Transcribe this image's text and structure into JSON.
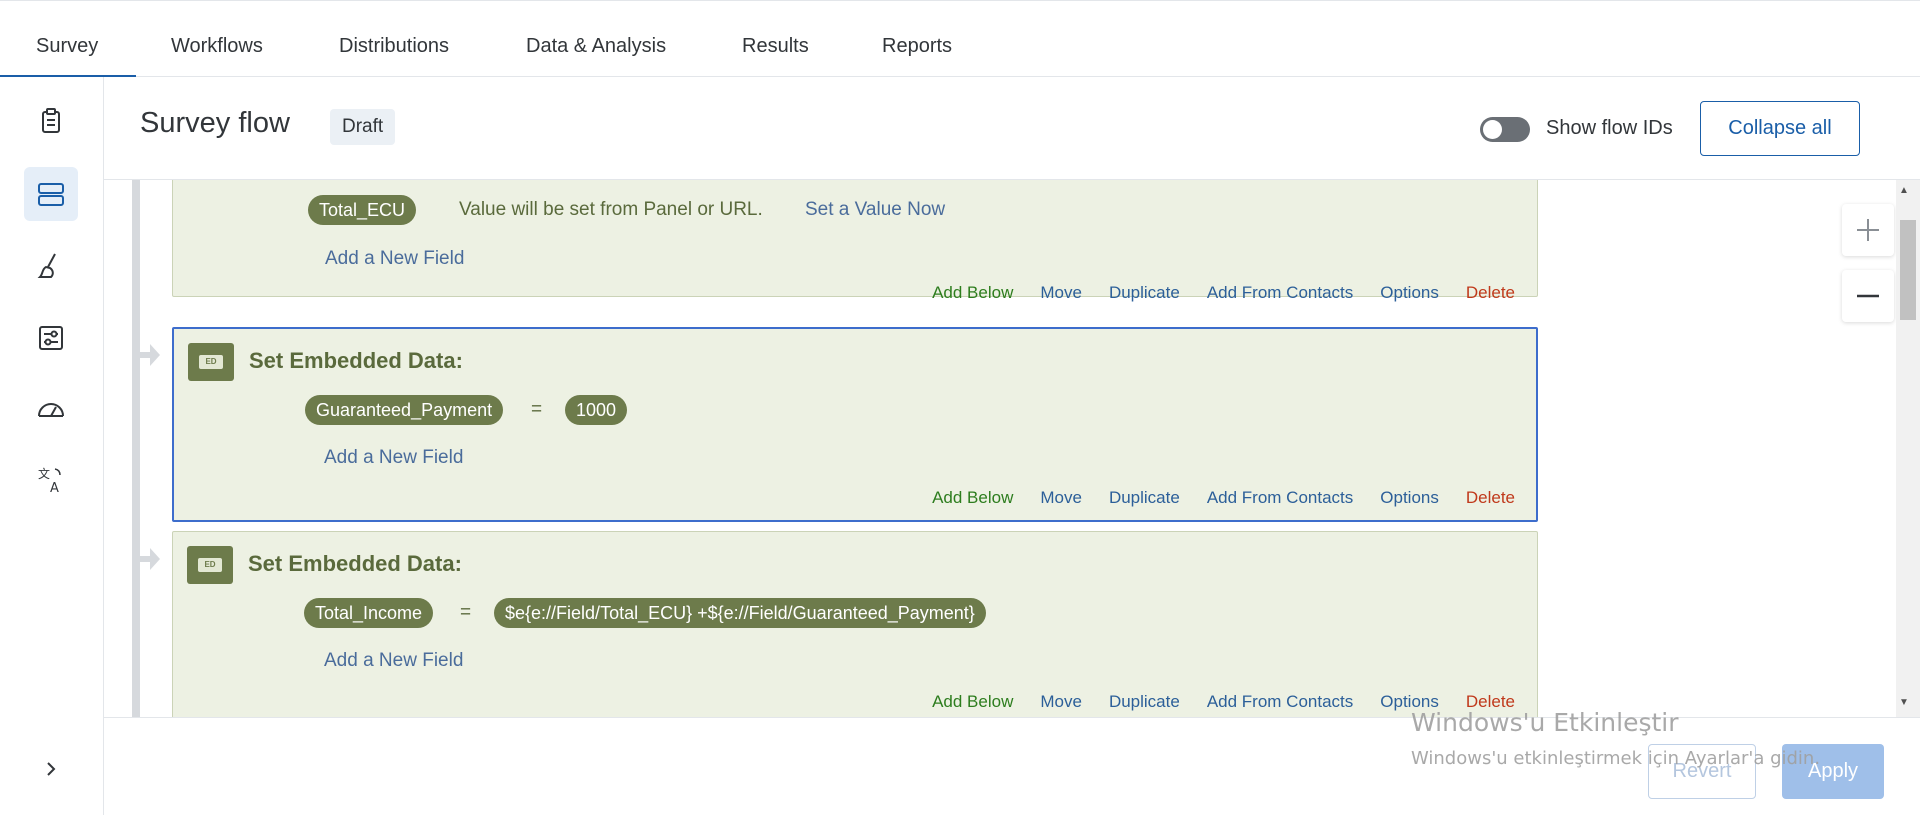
{
  "nav": {
    "tabs": [
      {
        "label": "Survey",
        "active": true
      },
      {
        "label": "Workflows"
      },
      {
        "label": "Distributions"
      },
      {
        "label": "Data & Analysis"
      },
      {
        "label": "Results"
      },
      {
        "label": "Reports"
      }
    ]
  },
  "rail": {
    "items": [
      {
        "icon": "clipboard-icon"
      },
      {
        "icon": "survey-flow-icon",
        "active": true
      },
      {
        "icon": "paintbrush-icon"
      },
      {
        "icon": "survey-options-icon"
      },
      {
        "icon": "gauge-icon"
      },
      {
        "icon": "translate-icon"
      }
    ],
    "expand_icon": "chevron-right-icon"
  },
  "header": {
    "title": "Survey flow",
    "badge": "Draft",
    "toggle_label": "Show flow IDs",
    "toggle_on": false,
    "collapse_label": "Collapse all"
  },
  "colors": {
    "accent": "#1a5ea8",
    "block_bg": "#edf1e3",
    "pill": "#6d7b4b",
    "selected_border": "#3d6dcc",
    "add_below": "#2d7d1e",
    "delete": "#c0391b"
  },
  "flow": {
    "common": {
      "title": "Set Embedded Data:",
      "icon_text": "ED",
      "add_field": "Add a New Field",
      "eq": "=",
      "actions": {
        "add_below": "Add Below",
        "move": "Move",
        "duplicate": "Duplicate",
        "add_from_contacts": "Add From Contacts",
        "options": "Options",
        "delete": "Delete"
      }
    },
    "blocks": [
      {
        "field": "Total_ECU",
        "note": "Value will be set from Panel or URL.",
        "set_value_link": "Set a Value Now"
      },
      {
        "field": "Guaranteed_Payment",
        "value": "1000",
        "selected": true
      },
      {
        "field": "Total_Income",
        "value": "$e{e://Field/Total_ECU} +${e://Field/Guaranteed_Payment}"
      }
    ]
  },
  "footer": {
    "revert": "Revert",
    "apply": "Apply"
  },
  "watermark": {
    "title": "Windows'u Etkinleştir",
    "subtitle": "Windows'u etkinleştirmek için Ayarlar'a gidin."
  }
}
